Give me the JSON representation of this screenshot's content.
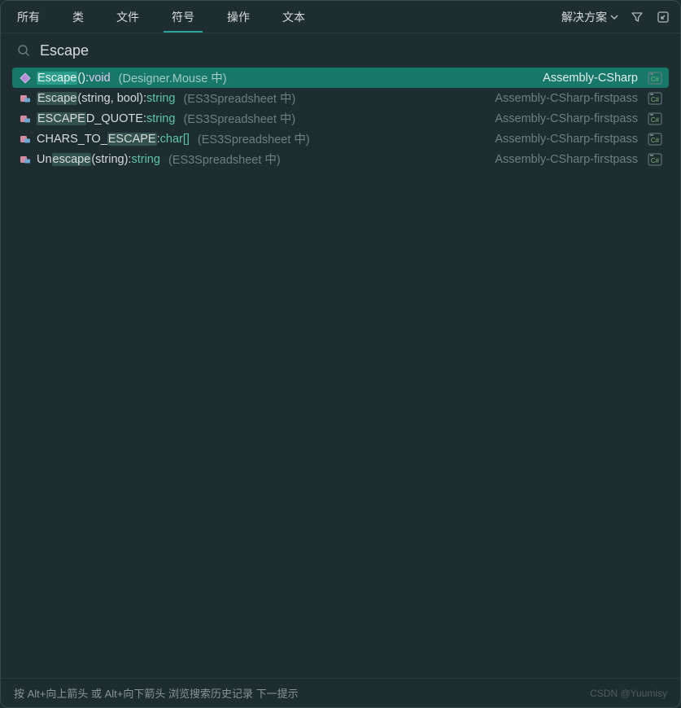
{
  "tabs": {
    "all": "所有",
    "classes": "类",
    "files": "文件",
    "symbols": "符号",
    "actions": "操作",
    "text": "文本"
  },
  "active_tab_key": "symbols",
  "header": {
    "scope_label": "解决方案"
  },
  "search": {
    "query": "Escape"
  },
  "results": [
    {
      "icon": "method",
      "highlight": "Escape",
      "name_rest": "",
      "signature": "():",
      "return_type": "void",
      "return_kind": "void",
      "context": "(Designer.Mouse 中)",
      "assembly": "Assembly-CSharp",
      "selected": true
    },
    {
      "icon": "method-ext",
      "highlight": "Escape",
      "name_rest": "",
      "signature": "(string, bool):",
      "return_type": "string",
      "return_kind": "string",
      "context": "(ES3Spreadsheet 中)",
      "assembly": "Assembly-CSharp-firstpass",
      "selected": false
    },
    {
      "icon": "field",
      "highlight": "ESCAPE",
      "name_rest": "D_QUOTE",
      "signature": ":",
      "return_type": "string",
      "return_kind": "string",
      "context": "(ES3Spreadsheet 中)",
      "assembly": "Assembly-CSharp-firstpass",
      "selected": false
    },
    {
      "icon": "field",
      "highlight": "ESCAPE",
      "name_rest": "",
      "prefix": "CHARS_TO_",
      "signature": ":",
      "return_type": "char[]",
      "return_kind": "charr",
      "context": "(ES3Spreadsheet 中)",
      "assembly": "Assembly-CSharp-firstpass",
      "selected": false
    },
    {
      "icon": "method-ext",
      "highlight": "escape",
      "name_rest": "",
      "prefix": "Un",
      "signature": "(string):",
      "return_type": "string",
      "return_kind": "string",
      "context": "(ES3Spreadsheet 中)",
      "assembly": "Assembly-CSharp-firstpass",
      "selected": false
    }
  ],
  "footer": {
    "hint": "按 Alt+向上箭头 或 Alt+向下箭头 浏览搜索历史记录  下一提示",
    "watermark": "CSDN @Yuumisy"
  }
}
